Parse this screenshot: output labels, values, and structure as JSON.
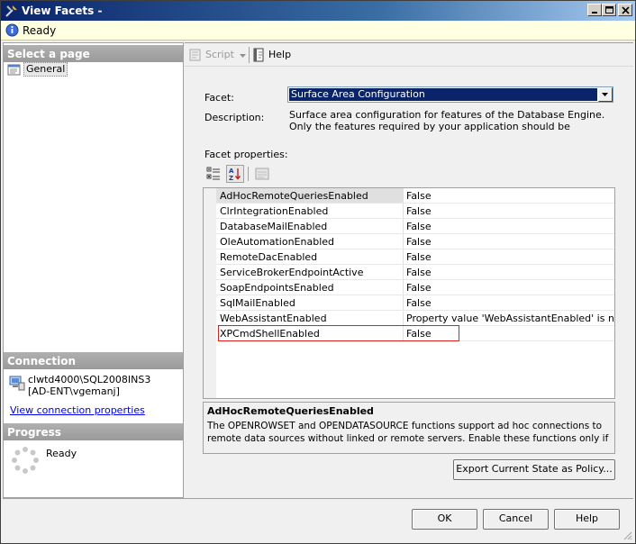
{
  "window": {
    "title": "View Facets -"
  },
  "status": {
    "text": "Ready"
  },
  "left": {
    "select_page_header": "Select a page",
    "pages": [
      {
        "label": "General"
      }
    ],
    "connection_header": "Connection",
    "connection_server": "clwtd4000\\SQL2008INS3",
    "connection_user": "[AD-ENT\\vgemanj]",
    "connection_link": "View connection properties",
    "progress_header": "Progress",
    "progress_text": "Ready"
  },
  "toolbar": {
    "script_label": "Script",
    "help_label": "Help"
  },
  "main": {
    "facet_label": "Facet:",
    "facet_value": "Surface Area Configuration",
    "description_label": "Description:",
    "description_text": "Surface area configuration for features of the Database Engine. Only the features required by your application should be enabled. Disabling unused",
    "facet_properties_label": "Facet properties:",
    "properties": [
      {
        "name": "AdHocRemoteQueriesEnabled",
        "value": "False"
      },
      {
        "name": "ClrIntegrationEnabled",
        "value": "False"
      },
      {
        "name": "DatabaseMailEnabled",
        "value": "False"
      },
      {
        "name": "OleAutomationEnabled",
        "value": "False"
      },
      {
        "name": "RemoteDacEnabled",
        "value": "False"
      },
      {
        "name": "ServiceBrokerEndpointActive",
        "value": "False"
      },
      {
        "name": "SoapEndpointsEnabled",
        "value": "False"
      },
      {
        "name": "SqlMailEnabled",
        "value": "False"
      },
      {
        "name": "WebAssistantEnabled",
        "value": "Property value 'WebAssistantEnabled' is not available"
      },
      {
        "name": "XPCmdShellEnabled",
        "value": "False"
      }
    ],
    "help_title": "AdHocRemoteQueriesEnabled",
    "help_text": "The OPENROWSET and OPENDATASOURCE functions support ad hoc connections to remote data sources without linked or remote servers. Enable these functions only if your applicat...",
    "export_button": "Export Current State as Policy..."
  },
  "footer": {
    "ok": "OK",
    "cancel": "Cancel",
    "help": "Help"
  }
}
